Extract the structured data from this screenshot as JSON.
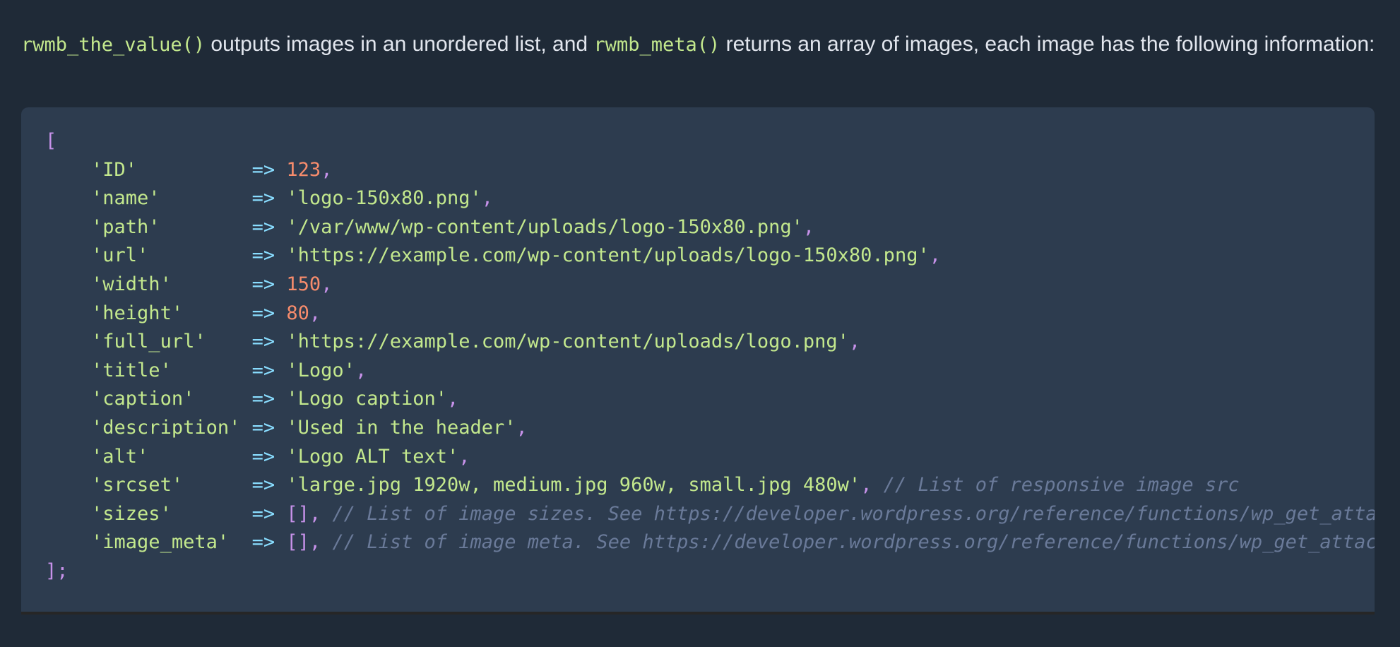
{
  "intro": {
    "code_1": "rwmb_the_value()",
    "text_1": " outputs images in an unordered list, and ",
    "code_2": "rwmb_meta()",
    "text_2": " returns an array of images, each image has the following information:"
  },
  "code": {
    "open": "[",
    "close": "];",
    "arrow": "=>",
    "comma": ",",
    "entries": [
      {
        "key": "'ID'",
        "pad": "          ",
        "value": "123",
        "vtype": "num",
        "comment": ""
      },
      {
        "key": "'name'",
        "pad": "        ",
        "value": "'logo-150x80.png'",
        "vtype": "str",
        "comment": ""
      },
      {
        "key": "'path'",
        "pad": "        ",
        "value": "'/var/www/wp-content/uploads/logo-150x80.png'",
        "vtype": "str",
        "comment": ""
      },
      {
        "key": "'url'",
        "pad": "         ",
        "value": "'https://example.com/wp-content/uploads/logo-150x80.png'",
        "vtype": "str",
        "comment": ""
      },
      {
        "key": "'width'",
        "pad": "       ",
        "value": "150",
        "vtype": "num",
        "comment": ""
      },
      {
        "key": "'height'",
        "pad": "      ",
        "value": "80",
        "vtype": "num",
        "comment": ""
      },
      {
        "key": "'full_url'",
        "pad": "    ",
        "value": "'https://example.com/wp-content/uploads/logo.png'",
        "vtype": "str",
        "comment": ""
      },
      {
        "key": "'title'",
        "pad": "       ",
        "value": "'Logo'",
        "vtype": "str",
        "comment": ""
      },
      {
        "key": "'caption'",
        "pad": "     ",
        "value": "'Logo caption'",
        "vtype": "str",
        "comment": ""
      },
      {
        "key": "'description'",
        "pad": " ",
        "value": "'Used in the header'",
        "vtype": "str",
        "comment": ""
      },
      {
        "key": "'alt'",
        "pad": "         ",
        "value": "'Logo ALT text'",
        "vtype": "str",
        "comment": ""
      },
      {
        "key": "'srcset'",
        "pad": "      ",
        "value": "'large.jpg 1920w, medium.jpg 960w, small.jpg 480w'",
        "vtype": "str",
        "comment": "// List of responsive image src"
      },
      {
        "key": "'sizes'",
        "pad": "       ",
        "value": "[]",
        "vtype": "arr",
        "comment": "// List of image sizes. See https://developer.wordpress.org/reference/functions/wp_get_attachment_metadata/"
      },
      {
        "key": "'image_meta'",
        "pad": "  ",
        "value": "[]",
        "vtype": "arr",
        "comment": "// List of image meta. See https://developer.wordpress.org/reference/functions/wp_get_attachment_metadata/"
      }
    ]
  }
}
